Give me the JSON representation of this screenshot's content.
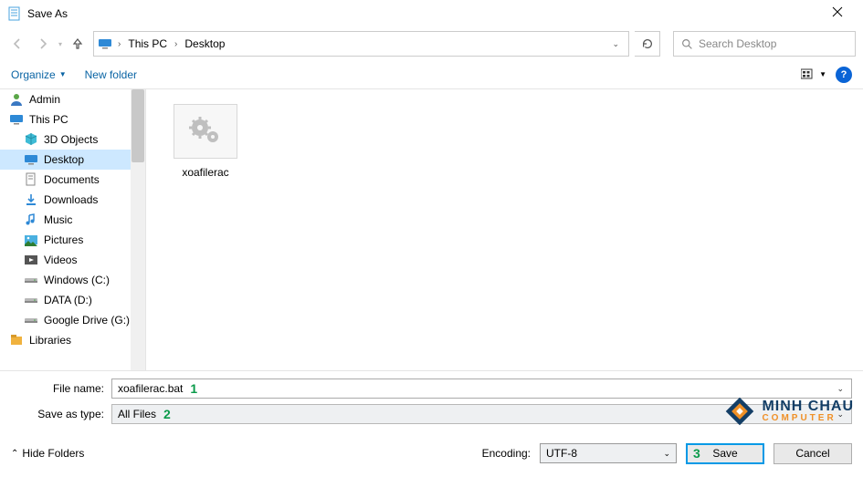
{
  "window": {
    "title": "Save As"
  },
  "nav": {
    "crumbs": [
      "This PC",
      "Desktop"
    ],
    "search_placeholder": "Search Desktop"
  },
  "toolbar": {
    "organize": "Organize",
    "new_folder": "New folder",
    "help": "?"
  },
  "tree": {
    "items": [
      {
        "label": "Admin",
        "icon": "user",
        "indent": false,
        "selected": false
      },
      {
        "label": "This PC",
        "icon": "pc",
        "indent": false,
        "selected": false
      },
      {
        "label": "3D Objects",
        "icon": "cube",
        "indent": true,
        "selected": false
      },
      {
        "label": "Desktop",
        "icon": "desktop",
        "indent": true,
        "selected": true
      },
      {
        "label": "Documents",
        "icon": "documents",
        "indent": true,
        "selected": false
      },
      {
        "label": "Downloads",
        "icon": "downloads",
        "indent": true,
        "selected": false
      },
      {
        "label": "Music",
        "icon": "music",
        "indent": true,
        "selected": false
      },
      {
        "label": "Pictures",
        "icon": "pictures",
        "indent": true,
        "selected": false
      },
      {
        "label": "Videos",
        "icon": "videos",
        "indent": true,
        "selected": false
      },
      {
        "label": "Windows (C:)",
        "icon": "drive",
        "indent": true,
        "selected": false
      },
      {
        "label": "DATA (D:)",
        "icon": "drive",
        "indent": true,
        "selected": false
      },
      {
        "label": "Google Drive (G:)",
        "icon": "drive",
        "indent": true,
        "selected": false
      },
      {
        "label": "Libraries",
        "icon": "libraries",
        "indent": false,
        "selected": false
      }
    ]
  },
  "content": {
    "files": [
      {
        "name": "xoafilerac",
        "icon": "batch-gears"
      }
    ]
  },
  "fields": {
    "file_name_label": "File name:",
    "file_name_value": "xoafilerac.bat",
    "save_type_label": "Save as type:",
    "save_type_value": "All Files"
  },
  "footer": {
    "hide_folders": "Hide Folders",
    "encoding_label": "Encoding:",
    "encoding_value": "UTF-8",
    "save": "Save",
    "cancel": "Cancel"
  },
  "annotations": {
    "one": "1",
    "two": "2",
    "three": "3"
  },
  "watermark": {
    "line1": "MINH CHAU",
    "line2": "COMPUTER"
  }
}
